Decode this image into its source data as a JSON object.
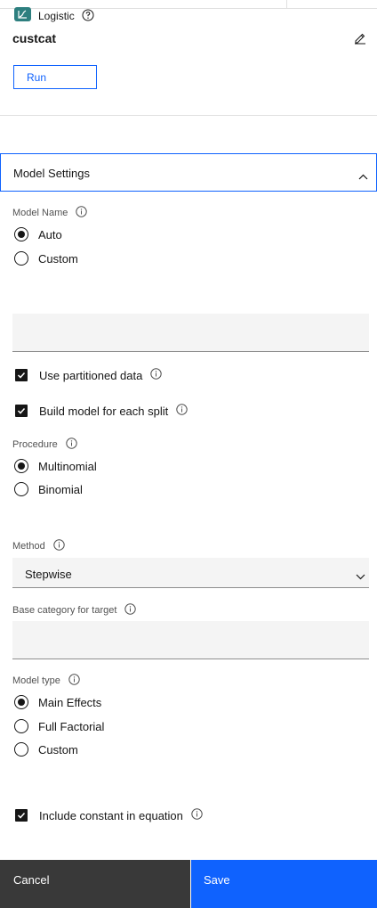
{
  "node": {
    "type_label": "Logistic",
    "title": "custcat",
    "run_label": "Run"
  },
  "accordion": {
    "title": "Model Settings"
  },
  "model_name": {
    "label": "Model Name",
    "options": [
      "Auto",
      "Custom"
    ],
    "selected": "Auto",
    "custom_value": ""
  },
  "use_partitioned": {
    "label": "Use partitioned data",
    "checked": true
  },
  "build_split": {
    "label": "Build model for each split",
    "checked": true
  },
  "procedure": {
    "label": "Procedure",
    "options": [
      "Multinomial",
      "Binomial"
    ],
    "selected": "Multinomial"
  },
  "method": {
    "label": "Method",
    "value": "Stepwise"
  },
  "base_category": {
    "label": "Base category for target",
    "value": ""
  },
  "model_type": {
    "label": "Model type",
    "options": [
      "Main Effects",
      "Full Factorial",
      "Custom"
    ],
    "selected": "Main Effects"
  },
  "include_constant": {
    "label": "Include constant in equation",
    "checked": true
  },
  "footer": {
    "cancel_label": "Cancel",
    "save_label": "Save"
  },
  "colors": {
    "accent": "#0f62fe",
    "node_icon": "#2d7f7f",
    "cancel_bg": "#393939"
  }
}
